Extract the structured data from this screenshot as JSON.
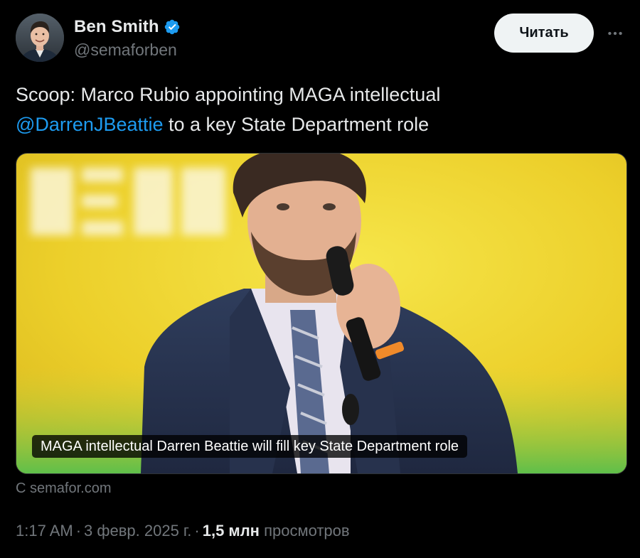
{
  "author": {
    "name": "Ben Smith",
    "handle": "@semaforben"
  },
  "header": {
    "follow_label": "Читать",
    "more_icon": "more-horizontal-icon",
    "verified_icon": "verified-badge-icon"
  },
  "tweet": {
    "text_before_mention": "Scoop: Marco Rubio appointing MAGA intellectual ",
    "mention": "@DarrenJBeattie",
    "text_after_mention": " to a key State Department role"
  },
  "card": {
    "title": "MAGA intellectual Darren Beattie will fill key State Department role",
    "source": "С semafor.com"
  },
  "meta": {
    "time": "1:17 AM",
    "separator": "·",
    "date": "3 февр. 2025 г.",
    "views_count": "1,5 млн",
    "views_label": "просмотров"
  },
  "colors": {
    "background": "#000000",
    "text_primary": "#e7e9ea",
    "text_secondary": "#71767b",
    "accent_blue": "#1d9bf0",
    "verified_blue": "#1d9bf0",
    "button_bg": "#eff3f4"
  }
}
